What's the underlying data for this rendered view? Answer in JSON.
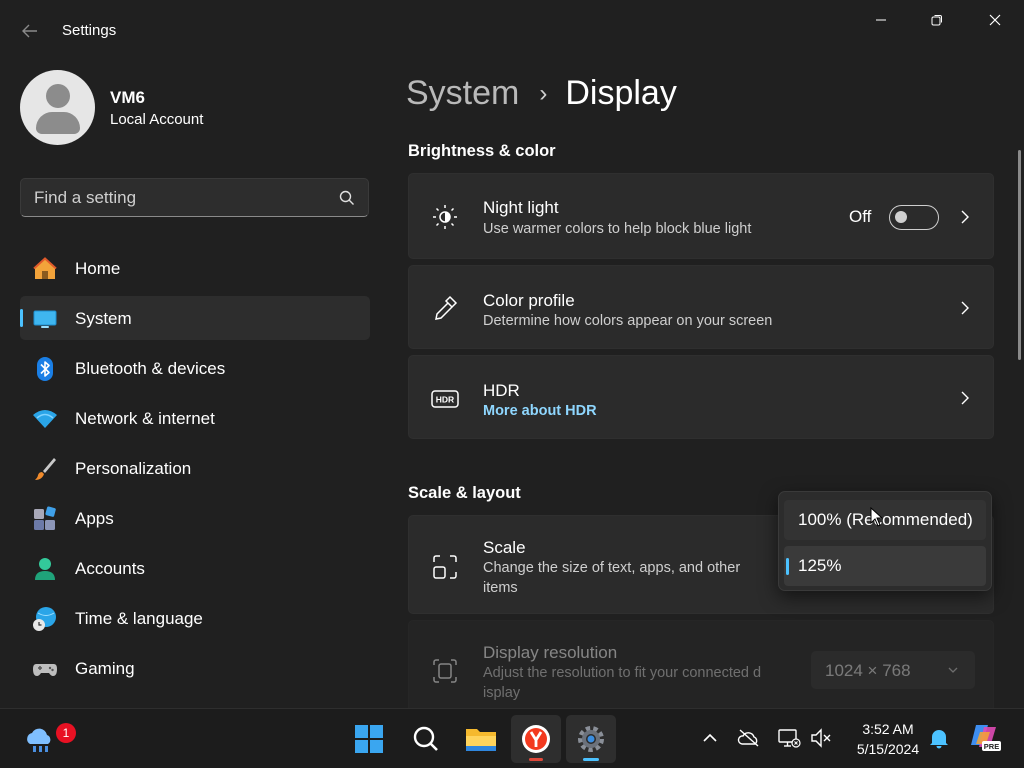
{
  "window": {
    "title": "Settings",
    "back_icon": "back-arrow-icon",
    "controls": [
      "minimize-icon",
      "restore-icon",
      "close-icon"
    ]
  },
  "profile": {
    "name": "VM6",
    "account_type": "Local Account"
  },
  "search": {
    "placeholder": "Find a setting",
    "icon": "search-icon"
  },
  "sidebar": {
    "items": [
      {
        "label": "Home",
        "icon": "home-icon",
        "active": false
      },
      {
        "label": "System",
        "icon": "system-display-icon",
        "active": true
      },
      {
        "label": "Bluetooth & devices",
        "icon": "bluetooth-icon",
        "active": false
      },
      {
        "label": "Network & internet",
        "icon": "wifi-icon",
        "active": false
      },
      {
        "label": "Personalization",
        "icon": "paintbrush-icon",
        "active": false
      },
      {
        "label": "Apps",
        "icon": "apps-icon",
        "active": false
      },
      {
        "label": "Accounts",
        "icon": "accounts-icon",
        "active": false
      },
      {
        "label": "Time & language",
        "icon": "time-language-icon",
        "active": false
      },
      {
        "label": "Gaming",
        "icon": "gamepad-icon",
        "active": false
      }
    ]
  },
  "main": {
    "breadcrumb": {
      "parent": "System",
      "separator": "›",
      "current": "Display"
    },
    "brightness_section": {
      "title": "Brightness & color",
      "night_light": {
        "title": "Night light",
        "subtitle": "Use warmer colors to help block blue light",
        "toggle_label": "Off",
        "toggle_on": false,
        "icon": "night-light-icon"
      },
      "color_profile": {
        "title": "Color profile",
        "subtitle": "Determine how colors appear on your screen",
        "icon": "eyedropper-icon"
      },
      "hdr": {
        "title": "HDR",
        "link": "More about HDR",
        "icon": "hdr-icon"
      }
    },
    "scale_section": {
      "title": "Scale & layout",
      "scale": {
        "title": "Scale",
        "subtitle_line1": "Change the size of text, apps, and other",
        "subtitle_line2": "items",
        "icon": "scale-icon"
      },
      "scale_options": [
        "100% (Recommended)",
        "125%"
      ],
      "scale_selected": "125%",
      "resolution": {
        "title": "Display resolution",
        "subtitle_line1": "Adjust the resolution to fit your connected d",
        "subtitle_line2": "isplay",
        "value": "1024 × 768",
        "icon": "resolution-icon"
      }
    }
  },
  "taskbar": {
    "widgets_badge": "1",
    "apps": [
      "start-icon",
      "search-icon",
      "file-explorer-icon",
      "yandex-browser-icon",
      "settings-icon"
    ],
    "tray": [
      "chevron-up-icon",
      "onedrive-offline-icon",
      "network-icon",
      "volume-muted-icon"
    ],
    "time": "3:52 AM",
    "date": "5/15/2024",
    "notification_icon": "bell-icon",
    "copilot_label": "PRE"
  },
  "colors": {
    "background": "#202020",
    "card": "#2b2b2b",
    "accent": "#4cc2ff",
    "link": "#8fd7ff",
    "taskbar": "#1c1c1c"
  }
}
